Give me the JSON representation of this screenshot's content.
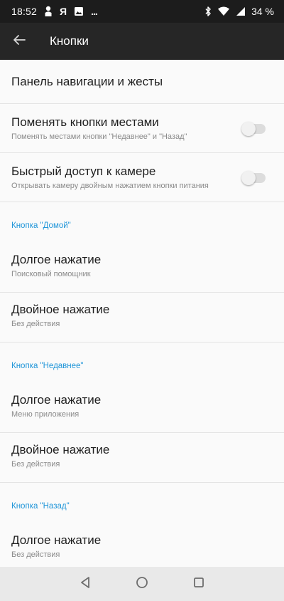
{
  "status_bar": {
    "time": "18:52",
    "notification_ya": "Я",
    "more_dots": "...",
    "battery_text": "34 %"
  },
  "app_bar": {
    "title": "Кнопки"
  },
  "items": {
    "nav_gestures": {
      "title": "Панель навигации и жесты"
    },
    "swap_buttons": {
      "title": "Поменять кнопки местами",
      "subtitle": "Поменять местами кнопки \"Недавнее\" и \"Назад\"",
      "enabled": false
    },
    "camera_quick": {
      "title": "Быстрый доступ к камере",
      "subtitle": "Открывать камеру двойным нажатием кнопки питания",
      "enabled": false
    }
  },
  "sections": {
    "home": {
      "header": "Кнопка \"Домой\"",
      "long_press": {
        "title": "Долгое нажатие",
        "value": "Поисковый помощник"
      },
      "double_tap": {
        "title": "Двойное нажатие",
        "value": "Без действия"
      }
    },
    "recents": {
      "header": "Кнопка \"Недавнее\"",
      "long_press": {
        "title": "Долгое нажатие",
        "value": "Меню приложения"
      },
      "double_tap": {
        "title": "Двойное нажатие",
        "value": "Без действия"
      }
    },
    "back": {
      "header": "Кнопка \"Назад\"",
      "long_press": {
        "title": "Долгое нажатие",
        "value": "Без действия"
      }
    }
  },
  "colors": {
    "accent": "#2196d9",
    "status_bar_bg": "#1c1c1c",
    "app_bar_bg": "#262626",
    "nav_bar_bg": "#e9e9e9"
  },
  "icons": [
    "person-icon",
    "image-icon",
    "bluetooth-icon",
    "wifi-icon",
    "signal-icon",
    "battery-icon",
    "back-arrow-icon",
    "nav-back-icon",
    "nav-home-icon",
    "nav-recents-icon"
  ]
}
